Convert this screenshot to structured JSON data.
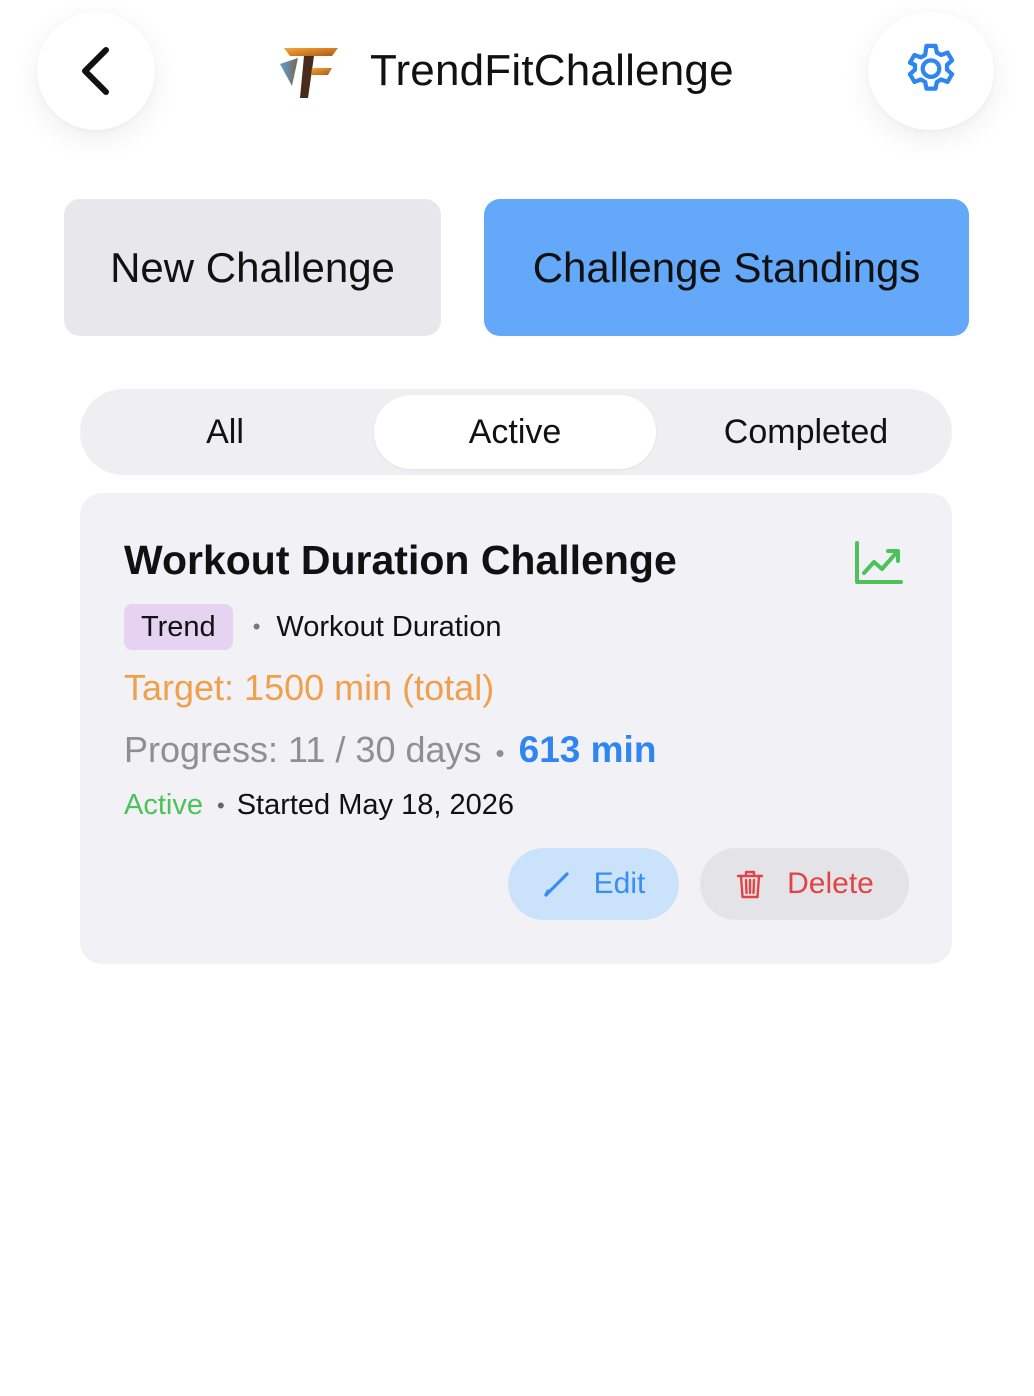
{
  "header": {
    "app_title": "TrendFitChallenge",
    "back_icon": "chevron-left-icon",
    "settings_icon": "gear-icon",
    "settings_color": "#2f86f0"
  },
  "actions": {
    "new_challenge": "New Challenge",
    "challenge_standings": "Challenge Standings"
  },
  "filter": {
    "tabs": [
      "All",
      "Active",
      "Completed"
    ],
    "selected": "Active"
  },
  "challenge": {
    "title": "Workout Duration Challenge",
    "type_badge": "Trend",
    "separator": "•",
    "metric": "Workout Duration",
    "target": "Target: 1500 min (total)",
    "progress": "Progress: 11 / 30 days",
    "minutes": "613 min",
    "status": "Active",
    "started": "Started May 18, 2026",
    "edit_label": "Edit",
    "delete_label": "Delete",
    "trend_icon": "trending-up-icon"
  },
  "colors": {
    "accent": "#64a8f9",
    "target": "#f0a04a",
    "status_active": "#4cc35a",
    "delete": "#e04545",
    "edit": "#3a8ef2",
    "badge": "#e6d3f1"
  }
}
